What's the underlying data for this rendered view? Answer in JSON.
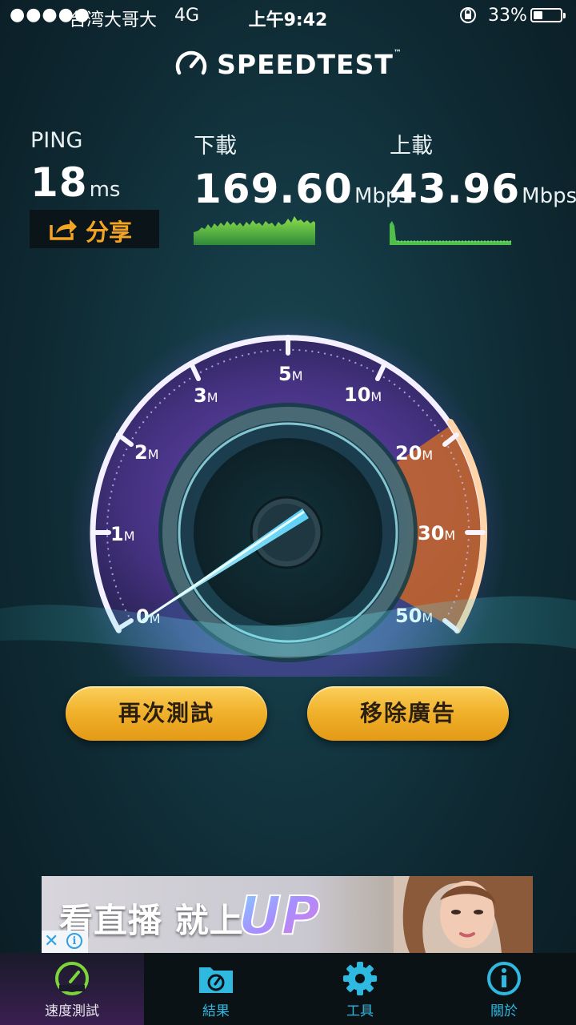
{
  "status_bar": {
    "signal": "●●●●●",
    "carrier": "台湾大哥大",
    "network": "4G",
    "time": "上午9:42",
    "battery_percent": "33%",
    "battery_level": 0.33
  },
  "brand": {
    "name": "SPEEDTEST",
    "trademark": "™"
  },
  "results": {
    "ping": {
      "label": "PING",
      "value": "18",
      "unit": "ms"
    },
    "download": {
      "label": "下載",
      "value": "169.60",
      "unit": "Mbps"
    },
    "upload": {
      "label": "上載",
      "value": "43.96",
      "unit": "Mbps"
    }
  },
  "share": {
    "label": "分享"
  },
  "gauge": {
    "ticks": [
      {
        "num": "0",
        "suffix": "M"
      },
      {
        "num": "1",
        "suffix": "M"
      },
      {
        "num": "2",
        "suffix": "M"
      },
      {
        "num": "3",
        "suffix": "M"
      },
      {
        "num": "5",
        "suffix": "M"
      },
      {
        "num": "10",
        "suffix": "M"
      },
      {
        "num": "20",
        "suffix": "M"
      },
      {
        "num": "30",
        "suffix": "M"
      },
      {
        "num": "50",
        "suffix": "M"
      }
    ],
    "colors": {
      "purple": "#5a3d9a",
      "orange": "#c96a2c",
      "needle": "#8ee8ff"
    }
  },
  "buttons": {
    "retest": "再次測試",
    "remove_ads": "移除廣告"
  },
  "ad": {
    "headline": "看直播 就上",
    "brand_text": "UP",
    "close": "✕",
    "info": "i"
  },
  "tabs": [
    {
      "label": "速度測試",
      "icon": "speedometer-icon",
      "active": true
    },
    {
      "label": "結果",
      "icon": "results-folder-icon",
      "active": false
    },
    {
      "label": "工具",
      "icon": "gear-icon",
      "active": false
    },
    {
      "label": "關於",
      "icon": "info-icon",
      "active": false
    }
  ],
  "colors": {
    "accent": "#f2a422",
    "tab_blue": "#2fb8e0",
    "active_tab": "#7cd63a"
  }
}
